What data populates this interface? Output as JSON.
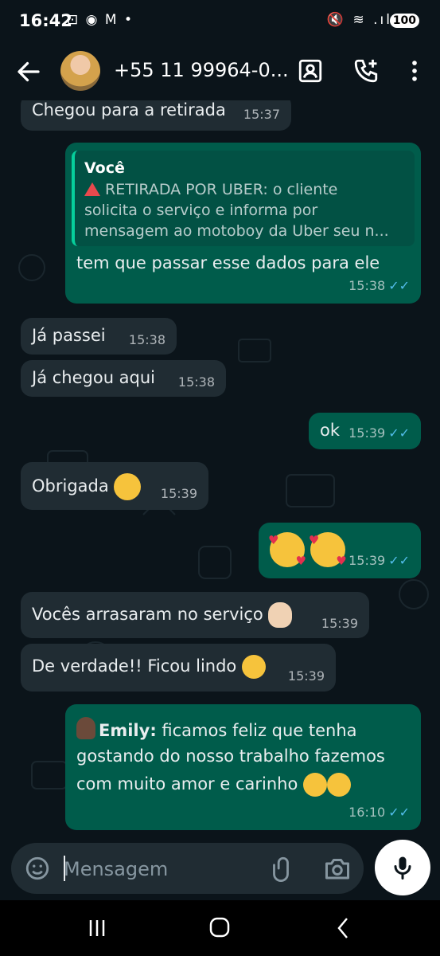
{
  "status": {
    "time": "16:42",
    "left_icons": "⊡ ◉ M •",
    "right_icons": "🔇 ≋ .ıl",
    "battery": "100"
  },
  "header": {
    "contact": "+55 11 99964-0..."
  },
  "messages": [
    {
      "dir": "in",
      "text": "Chegou para a retirada",
      "time": "15:37"
    },
    {
      "dir": "out",
      "quote_author": "Você",
      "quote_lines": [
        "RETIRADA POR  UBER: o cliente",
        "solicita o serviço e informa por",
        "mensagem ao motoboy da Uber seu n..."
      ],
      "text": "tem que passar esse dados para ele",
      "time": "15:38"
    },
    {
      "dir": "in",
      "text": "Já passei",
      "time": "15:38"
    },
    {
      "dir": "in",
      "text": "Já chegou aqui",
      "time": "15:38"
    },
    {
      "dir": "out",
      "text": "ok",
      "time": "15:39"
    },
    {
      "dir": "in",
      "text": "Obrigada",
      "emoji": "smiling-face-icon",
      "time": "15:39"
    },
    {
      "dir": "out",
      "emoji": "smiling-face-with-hearts-icon",
      "time": "15:39"
    },
    {
      "dir": "in",
      "text": "Vocês arrasaram no serviço",
      "emoji": "clapping-hands-icon",
      "time": "15:39"
    },
    {
      "dir": "in",
      "text": "De verdade!! Ficou lindo",
      "emoji": "star-struck-icon",
      "time": "15:39"
    },
    {
      "dir": "out",
      "author": "Emily:",
      "lines": [
        "ficamos feliz que tenha",
        "gostando do nosso trabalho fazemos",
        "com muito amor e carinho"
      ],
      "emoji": "hugging-face-icon",
      "time": "16:10"
    }
  ],
  "composer": {
    "placeholder": "Mensagem"
  },
  "colors": {
    "background": "#0b141a",
    "incoming": "#202c33",
    "outgoing": "#005c4b",
    "read_ticks": "#53bdeb",
    "accent": "#06cf9c"
  }
}
